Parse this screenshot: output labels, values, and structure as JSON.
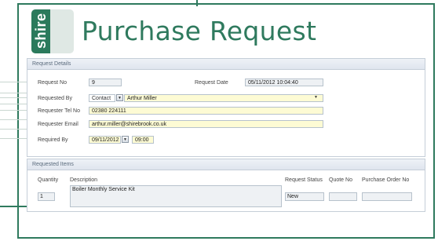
{
  "page": {
    "title": "Purchase Request",
    "logo_text": "shire"
  },
  "details": {
    "header": "Request Details",
    "request_no_label": "Request No",
    "request_no": "9",
    "request_date_label": "Request Date",
    "request_date": "05/11/2012 10:04:40",
    "requested_by_label": "Requested By",
    "requested_by_type": "Contact",
    "requested_by_name": "Arthur Miller",
    "tel_label": "Requester Tel No",
    "tel": "02380 224111",
    "email_label": "Requester Email",
    "email": "arthur.miller@shirebrook.co.uk",
    "required_by_label": "Required By",
    "required_by_date": "09/11/2012",
    "required_by_time": "09:00"
  },
  "items": {
    "header": "Requested Items",
    "columns": {
      "quantity": "Quantity",
      "description": "Description",
      "status": "Request Status",
      "quote": "Quote No",
      "po": "Purchase Order No"
    },
    "row": {
      "quantity": "1",
      "description": "Boiler Monthly Service Kit",
      "status": "New",
      "quote": "",
      "po": ""
    }
  },
  "colors": {
    "brand": "#2f7a5e",
    "field_highlight": "#fdfbd4"
  },
  "icons": {
    "dropdown": "chevron-down-icon"
  }
}
